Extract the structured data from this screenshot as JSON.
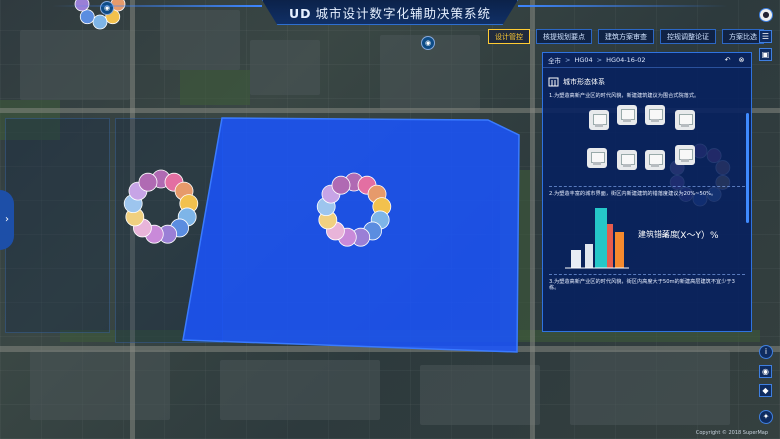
{
  "app": {
    "title_prefix": "UD",
    "title": "城市设计数字化辅助决策系统"
  },
  "nav": {
    "tabs": [
      {
        "label": "设计管控",
        "active": true
      },
      {
        "label": "核提规划要点",
        "active": false
      },
      {
        "label": "建筑方案审查",
        "active": false
      },
      {
        "label": "控规调整论证",
        "active": false
      },
      {
        "label": "方案比选",
        "active": false
      }
    ]
  },
  "panel": {
    "breadcrumb": [
      "全市",
      "HG04",
      "HG04-16-02"
    ],
    "section_title": "城市形态体系",
    "item1": "1.为塑造高新产业区的时代风貌，新建建筑建议为围合式院落式。",
    "item2": "2.为塑造丰富的城市界面，街区内新建建筑的错落度建议为20%~50%。",
    "item3": "3.为塑造高新产业区的时代风貌，街区内高度大于50m的新建高层建筑不宜少于3栋。",
    "formula_label": "建筑错落度",
    "formula": "= （X～Y）%"
  },
  "map": {
    "copyright": "Copyright © 2018 SuperMap"
  },
  "colors": {
    "site": "#1a55ff",
    "panel_bg": "#06205f",
    "accent": "#ffcc33",
    "border": "#2f73e0"
  },
  "icons": [
    "camera-icon",
    "menu-icon",
    "back-icon",
    "close-icon",
    "building-icon",
    "info-icon",
    "compass-icon",
    "chevron-right-icon",
    "toolbox-icon"
  ]
}
